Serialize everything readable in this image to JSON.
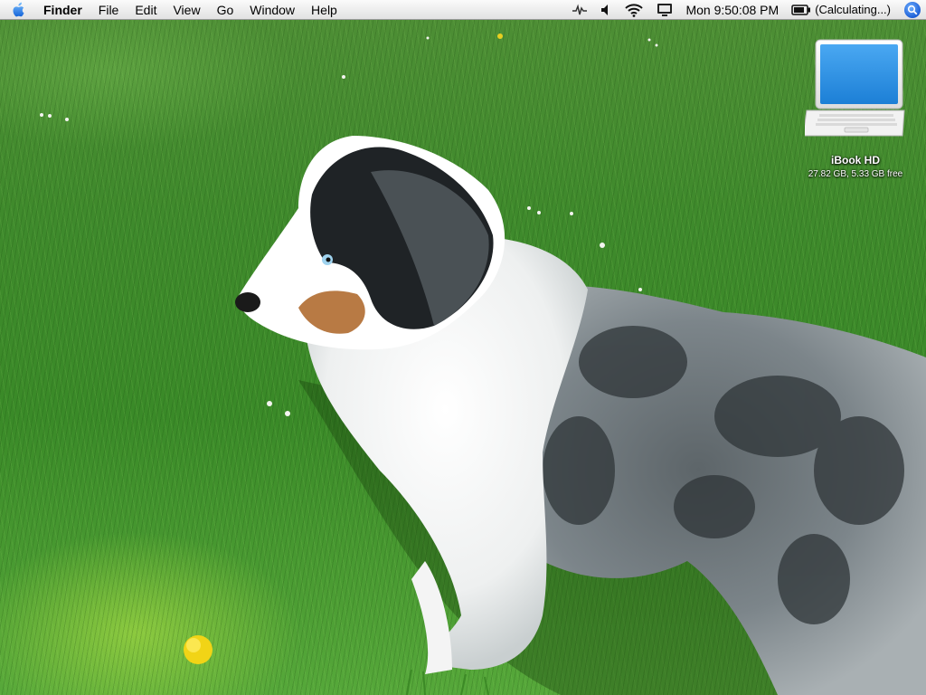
{
  "menubar": {
    "apple_icon": "apple-logo-icon",
    "app_name": "Finder",
    "items": [
      "File",
      "Edit",
      "View",
      "Go",
      "Window",
      "Help"
    ],
    "status": {
      "sound_icon": "volume-icon",
      "wifi_icon": "wifi-icon",
      "display_icon": "display-mirroring-icon",
      "clock": "Mon 9:50:08 PM",
      "battery_icon": "battery-icon",
      "battery_text": "(Calculating...)",
      "spotlight_icon": "spotlight-search-icon"
    }
  },
  "desktop": {
    "wallpaper": "australian-shepherd-on-grass",
    "icons": [
      {
        "icon": "ibook-laptop-icon",
        "label": "iBook HD",
        "sublabel": "27.82 GB, 5.33 GB free"
      }
    ]
  },
  "colors": {
    "menubar": "#eeeeee",
    "grass": "#3f8a2c",
    "spotlight": "#1d5fd6"
  }
}
